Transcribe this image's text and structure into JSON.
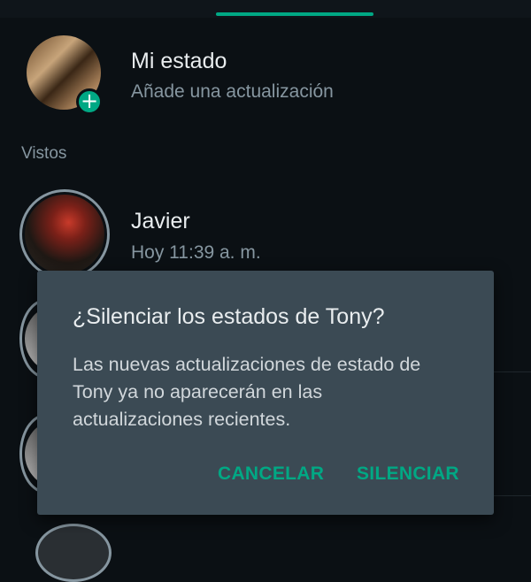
{
  "my_status": {
    "title": "Mi estado",
    "subtitle": "Añade una actualización",
    "add_icon": "plus-icon",
    "add_glyph": "+"
  },
  "section_viewed": "Vistos",
  "statuses": [
    {
      "name": "Javier",
      "time": "Hoy 11:39 a. m."
    }
  ],
  "dialog": {
    "title": "¿Silenciar los estados de Tony?",
    "body": "Las nuevas actualizaciones de estado de Tony ya no aparecerán en las actualizaciones recientes.",
    "cancel_label": "CANCELAR",
    "confirm_label": "SILENCIAR"
  },
  "colors": {
    "accent": "#00a884",
    "background": "#0b1014",
    "dialog_bg": "#3b4a54"
  }
}
